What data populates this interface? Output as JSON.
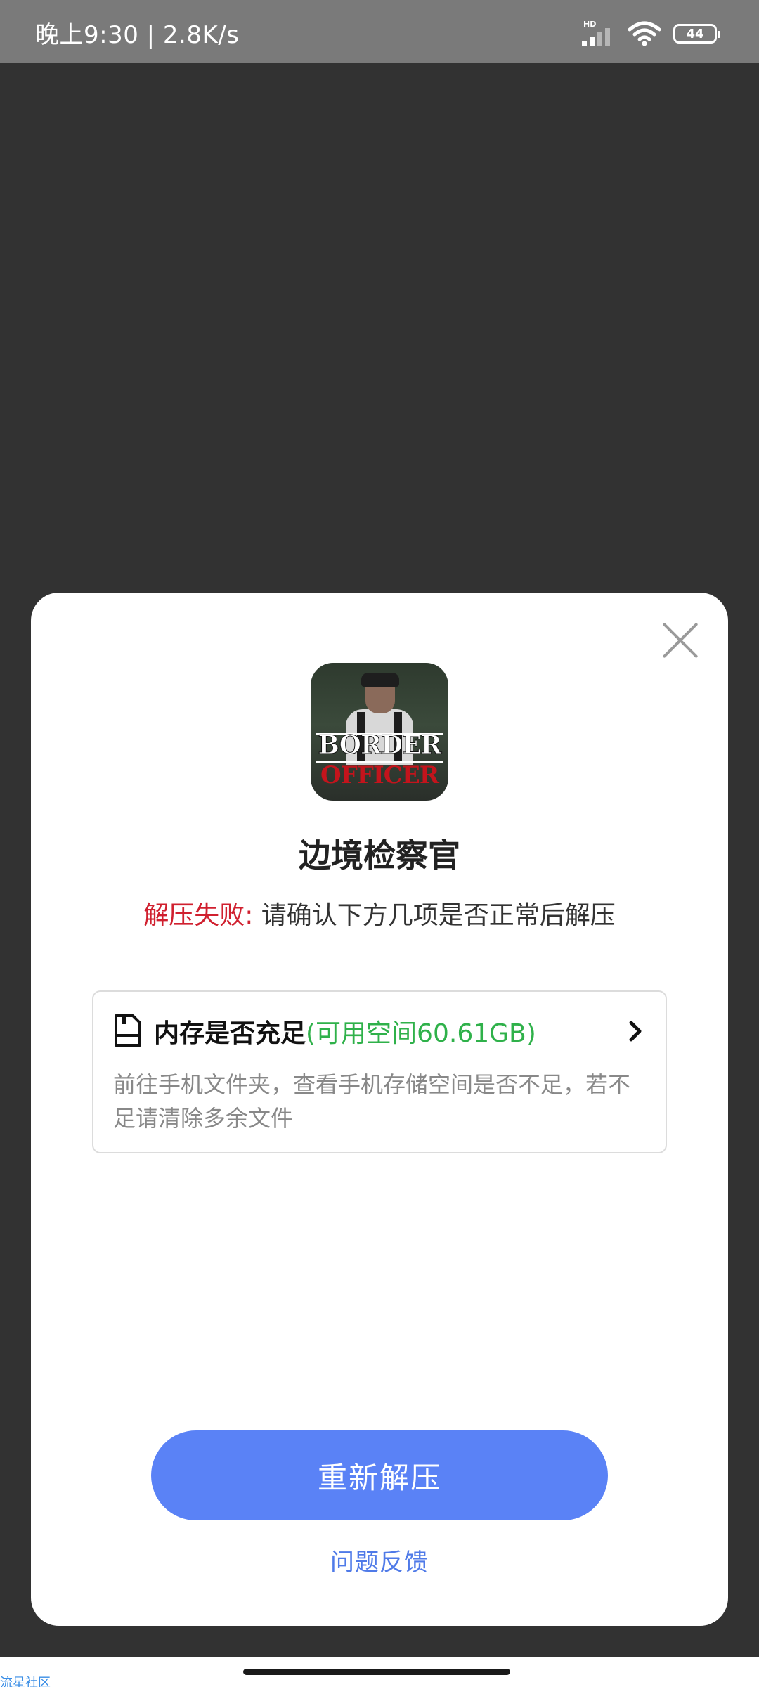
{
  "status_bar": {
    "time_speed": "晚上9:30 | 2.8K/s",
    "signal_label": "HD",
    "battery": "44"
  },
  "dialog": {
    "app_icon": {
      "text_line1": "BORDER",
      "text_line2": "OFFICER"
    },
    "game_title": "边境检察官",
    "error_label": "解压失败:",
    "error_message": "请确认下方几项是否正常后解压",
    "check_item": {
      "icon": "sd-card-icon",
      "title": "内存是否充足",
      "space_info": "(可用空间60.61GB)",
      "description": "前往手机文件夹，查看手机存储空间是否不足，若不足请清除多余文件"
    },
    "retry_button": "重新解压",
    "feedback_link": "问题反馈"
  },
  "watermark": "流星社区",
  "colors": {
    "overlay": "#323232",
    "status_bar": "#7a7a7a",
    "accent_blue": "#5a82f6",
    "error_red": "#d0202f",
    "space_green": "#2fb14a"
  }
}
